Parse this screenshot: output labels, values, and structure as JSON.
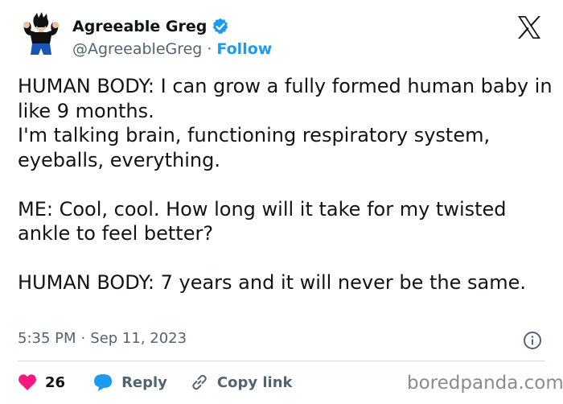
{
  "author": {
    "display_name": "Agreeable Greg",
    "handle": "@AgreeableGreg",
    "separator": "·",
    "follow_label": "Follow",
    "verified": true
  },
  "tweet": {
    "paragraphs": [
      "HUMAN BODY: I can grow a fully formed human baby in like 9 months.",
      "I'm talking brain, functioning respiratory system, eyeballs, everything.",
      "",
      "ME: Cool, cool. How long will it take for my twisted ankle to feel better?",
      "",
      "HUMAN BODY: 7 years and it will never be the same."
    ],
    "time": "5:35 PM",
    "date_separator": "·",
    "date": "Sep 11, 2023"
  },
  "actions": {
    "like_count": "26",
    "reply_label": "Reply",
    "copy_link_label": "Copy link"
  },
  "watermark": "boredpanda.com",
  "colors": {
    "accent": "#1d9bf0",
    "like": "#f91880",
    "muted": "#536471",
    "text": "#0f1419"
  },
  "icons": {
    "x_logo": "x-logo-icon",
    "verified": "verified-badge-icon",
    "info": "info-icon",
    "like": "heart-icon",
    "reply": "reply-bubble-icon",
    "copy_link": "link-icon"
  }
}
